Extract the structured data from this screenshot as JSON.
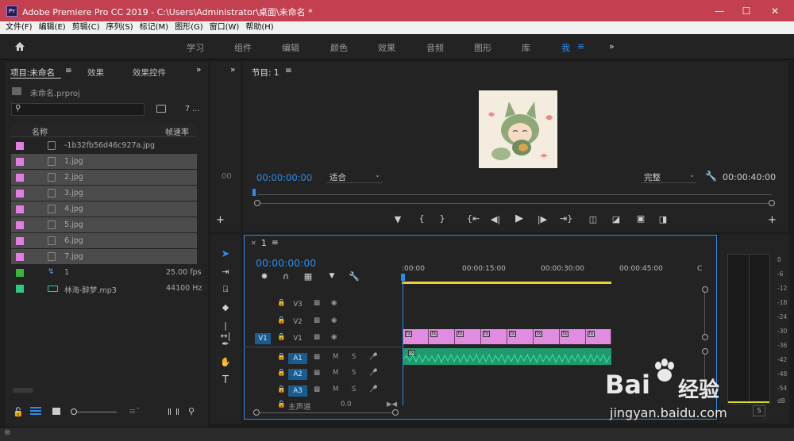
{
  "titlebar": {
    "title": "Adobe Premiere Pro CC 2019 - C:\\Users\\Administrator\\桌面\\未命名 *",
    "app_icon": "Pr"
  },
  "menubar": [
    "文件(F)",
    "编辑(E)",
    "剪辑(C)",
    "序列(S)",
    "标记(M)",
    "图形(G)",
    "窗口(W)",
    "帮助(H)"
  ],
  "workspaces": [
    "学习",
    "组件",
    "编辑",
    "颜色",
    "效果",
    "音频",
    "图形",
    "库",
    "我"
  ],
  "project": {
    "tabs": [
      "项目:未命名",
      "效果",
      "效果控件"
    ],
    "file": "未命名.prproj",
    "count": "7 ...",
    "col_name": "名称",
    "col_fps": "帧速率",
    "items": [
      {
        "name": "-1b32fb56d46c927a.jpg",
        "fps": "",
        "color": "#e27ee2",
        "sel": false
      },
      {
        "name": "1.jpg",
        "fps": "",
        "color": "#e27ee2",
        "sel": true
      },
      {
        "name": "2.jpg",
        "fps": "",
        "color": "#e27ee2",
        "sel": true
      },
      {
        "name": "3.jpg",
        "fps": "",
        "color": "#e27ee2",
        "sel": true
      },
      {
        "name": "4.jpg",
        "fps": "",
        "color": "#e27ee2",
        "sel": true
      },
      {
        "name": "5.jpg",
        "fps": "",
        "color": "#e27ee2",
        "sel": true
      },
      {
        "name": "6.jpg",
        "fps": "",
        "color": "#e27ee2",
        "sel": true
      },
      {
        "name": "7.jpg",
        "fps": "",
        "color": "#e27ee2",
        "sel": true
      },
      {
        "name": "1",
        "fps": "25.00 fps",
        "color": "#3db53d",
        "sel": false
      },
      {
        "name": "林海-醉梦.mp3",
        "fps": "44100 Hz",
        "color": "#2ec88a",
        "sel": false
      }
    ]
  },
  "source": {
    "timecode": "00"
  },
  "program": {
    "title": "节目: 1",
    "timecode": "00:00:00:00",
    "fit": "适合",
    "quality": "完整",
    "duration": "00:00:40:00"
  },
  "timeline": {
    "title": "1",
    "timecode": "00:00:00:00",
    "ruler": [
      ":00:00",
      "00:00:15:00",
      "00:00:30:00",
      "00:00:45:00",
      "C"
    ],
    "tracks": {
      "v3": "V3",
      "v2": "V2",
      "v1": "V1",
      "v1_src": "V1",
      "a1": "A1",
      "a2": "A2",
      "a3": "A3",
      "a1_src": "A1",
      "m": "M",
      "s": "S",
      "master": "主声道",
      "master_val": "0.0"
    }
  },
  "meters": {
    "labels": [
      "0",
      "-6",
      "-12",
      "-18",
      "-24",
      "-30",
      "-36",
      "-42",
      "-48",
      "-54",
      "dB"
    ],
    "s_label": "S"
  },
  "watermark": {
    "line1": "Bai",
    "line2": "经验",
    "url": "jingyan.baidu.com"
  }
}
